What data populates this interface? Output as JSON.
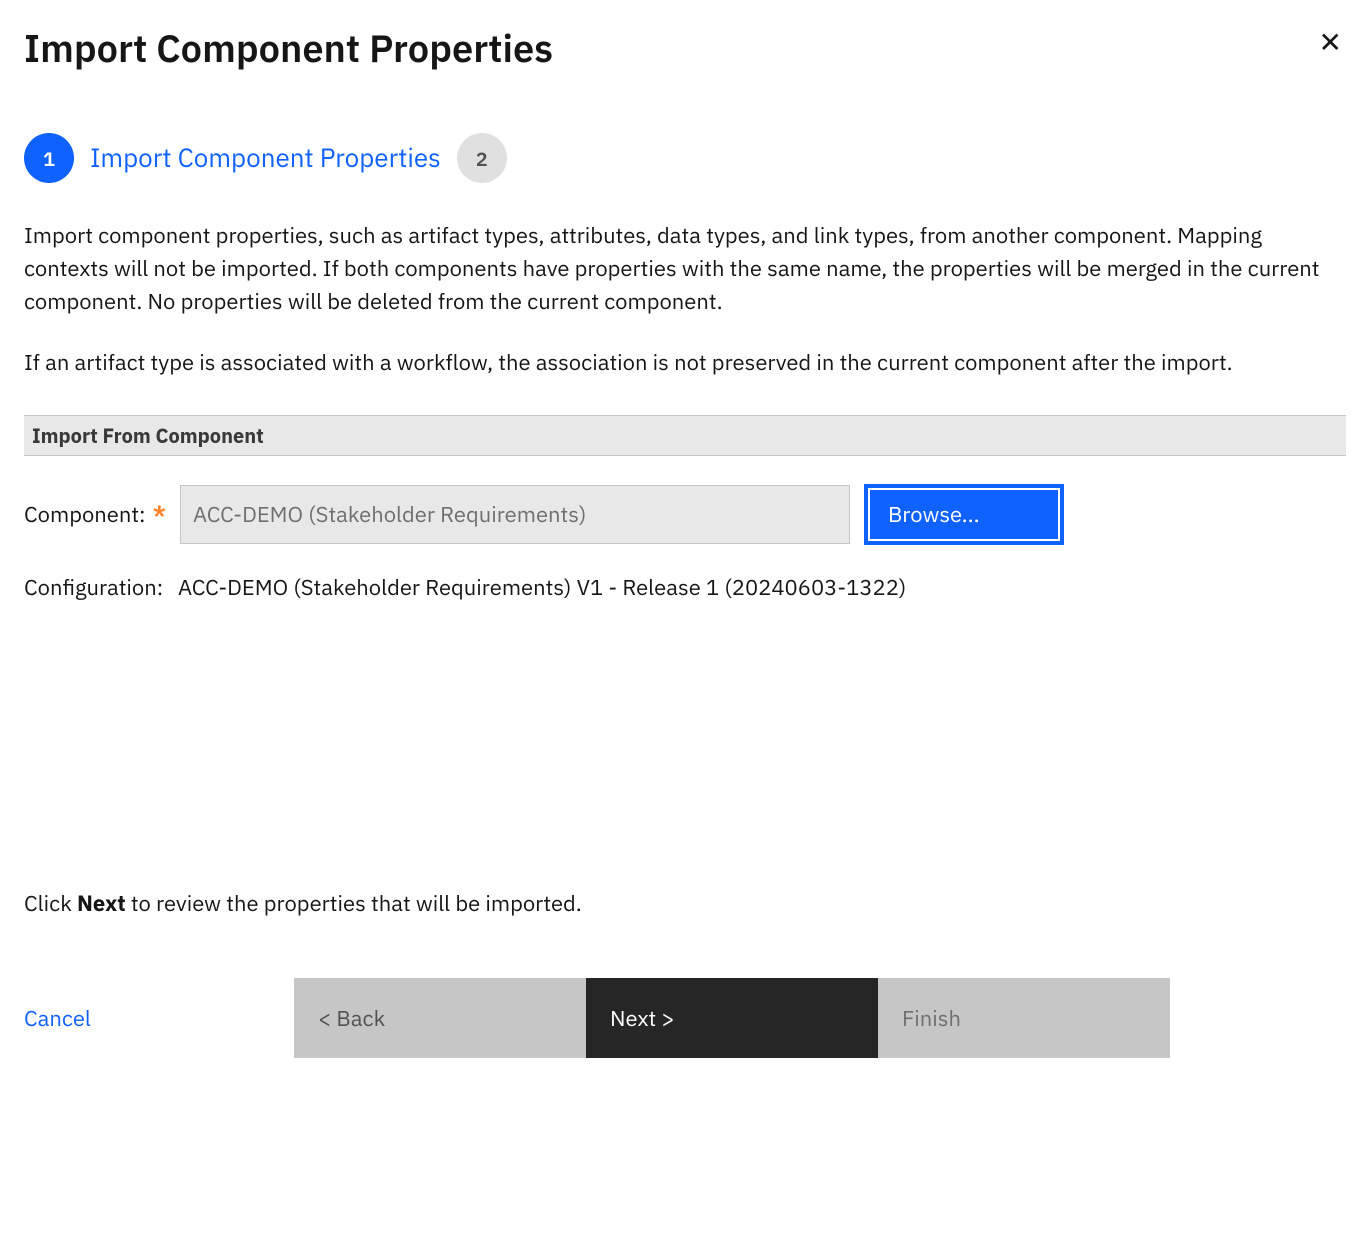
{
  "dialog": {
    "title": "Import Component Properties",
    "close_symbol": "✕"
  },
  "stepper": {
    "step1_number": "1",
    "step1_label": "Import Component Properties",
    "step2_number": "2"
  },
  "description": {
    "para1": "Import component properties, such as artifact types, attributes, data types, and link types, from another component. Mapping contexts will not be imported. If both components have properties with the same name, the properties will be merged in the current component. No properties will be deleted from the current component.",
    "para2": "If an artifact type is associated with a workflow, the association is not preserved in the current component after the import."
  },
  "section": {
    "header": "Import From Component"
  },
  "form": {
    "component_label": "Component:",
    "required_star": "*",
    "component_value": "ACC-DEMO (Stakeholder Requirements)",
    "browse_label": "Browse...",
    "configuration_label": "Configuration:",
    "configuration_value": "ACC-DEMO (Stakeholder Requirements) V1 - Release 1 (20240603-1322)"
  },
  "instruction": {
    "prefix": "Click ",
    "bold": "Next",
    "suffix": " to review the properties that will be imported."
  },
  "buttons": {
    "cancel": "Cancel",
    "back": "< Back",
    "next": "Next >",
    "finish": "Finish"
  }
}
